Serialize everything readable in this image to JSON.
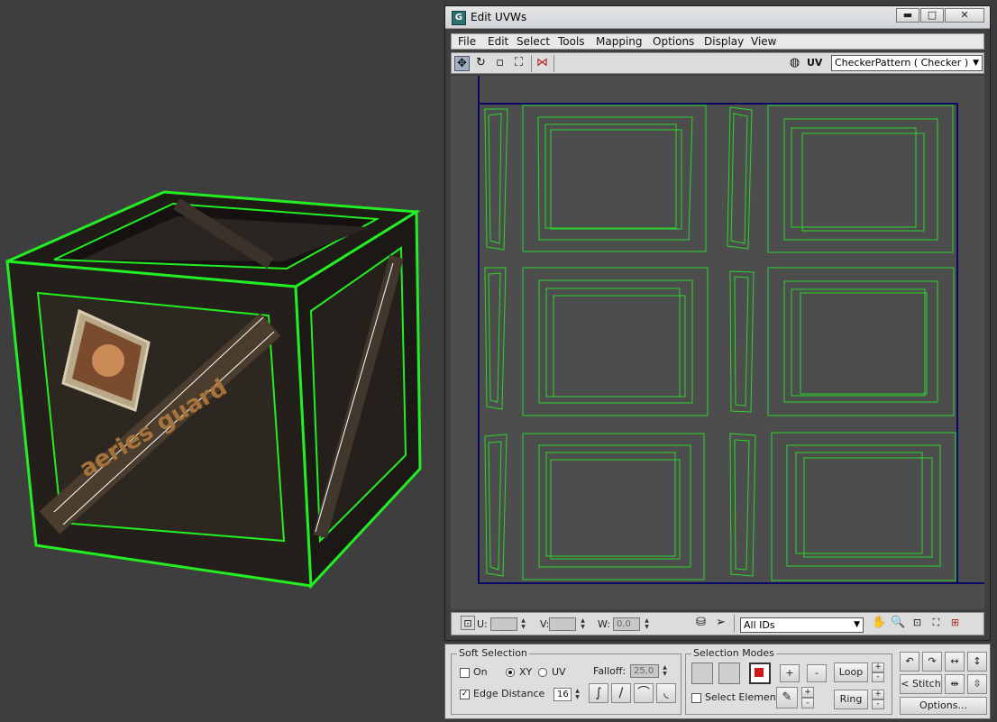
{
  "window": {
    "title": "Edit UVWs",
    "app_icon": "G",
    "controls": {
      "minimize": "▬",
      "maximize": "□",
      "close": "✕"
    }
  },
  "menu": [
    "File",
    "Edit",
    "Select",
    "Tools",
    "Mapping",
    "Options",
    "Display",
    "View"
  ],
  "toolbar": {
    "icons": [
      "move-icon",
      "rotate-icon",
      "scale-icon",
      "freeform-icon",
      "mirror-icon"
    ],
    "uv_label": "UV",
    "texture_select": "CheckerPattern  ( Checker )"
  },
  "statusbar": {
    "u_label": "U:",
    "v_label": "V:",
    "w_label": "W:",
    "u_value": "",
    "v_value": "",
    "w_value": "0,0",
    "ids_select": "All IDs"
  },
  "soft_selection": {
    "title": "Soft Selection",
    "on_label": "On",
    "on_checked": false,
    "xy_label": "XY",
    "uv_label": "UV",
    "xy_selected": true,
    "falloff_label": "Falloff:",
    "falloff_value": "25,0",
    "edge_distance_label": "Edge Distance",
    "edge_distance_checked": true,
    "edge_distance_value": "16"
  },
  "selection_modes": {
    "title": "Selection Modes",
    "select_element_label": "Select Element",
    "select_element_checked": false,
    "plus": "+",
    "minus": "-",
    "loop_label": "Loop",
    "ring_label": "Ring"
  },
  "right_tools": {
    "stitch_label": "Stitch",
    "options_label": "Options..."
  },
  "viewport": {
    "crate_text": "aeries guard"
  }
}
